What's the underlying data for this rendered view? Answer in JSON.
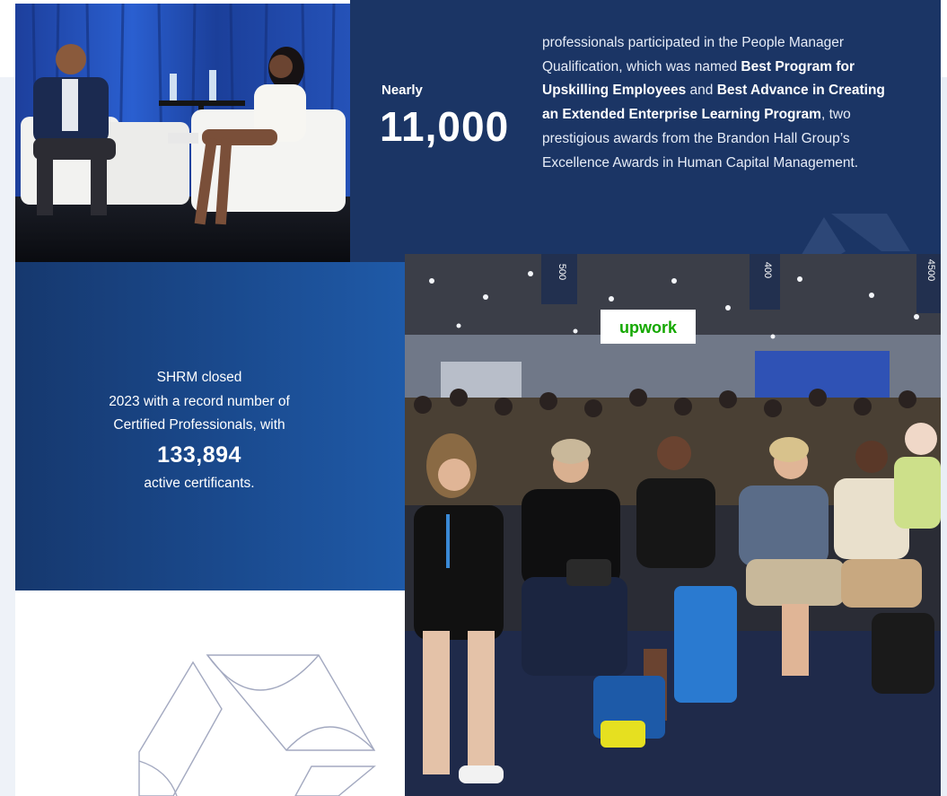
{
  "stat": {
    "prefix": "Nearly",
    "number": "11,000",
    "desc_1": "professionals participated in the People Manager Qualification, which was named ",
    "award_1": "Best Program for Upskilling Employees",
    "desc_2": " and ",
    "award_2": "Best Advance in Creating an Extended Enterprise Learning Program",
    "desc_3": ", two prestigious awards from the Brandon Hall Group’s Excellence Awards in Human Capital Management."
  },
  "certs": {
    "line_1": "SHRM closed",
    "line_2": "2023 with a record number of",
    "line_3": "Certified Professionals, with",
    "number": "133,894",
    "line_4": "active certificants."
  },
  "crowd_photo": {
    "booth_sign": "upwork",
    "banner_1": "500",
    "banner_2": "400",
    "banner_3": "4500"
  },
  "colors": {
    "navy": "#1b3565",
    "blue": "#1a4a8e",
    "white": "#ffffff"
  }
}
